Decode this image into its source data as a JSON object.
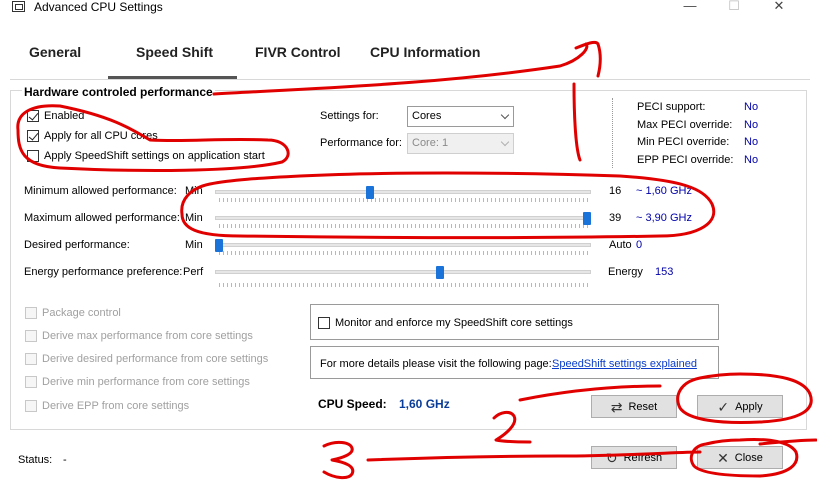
{
  "window": {
    "title": "Advanced CPU Settings",
    "minimize_glyph": "—",
    "maximize_glyph": "☐",
    "close_glyph": "✕"
  },
  "tabs": [
    {
      "label": "General",
      "active": false
    },
    {
      "label": "Speed Shift",
      "active": true
    },
    {
      "label": "FIVR Control",
      "active": false
    },
    {
      "label": "CPU Information",
      "active": false
    }
  ],
  "hardware": {
    "group_title": "Hardware controled performance",
    "enabled": {
      "label": "Enabled",
      "checked": true
    },
    "apply_all": {
      "label": "Apply for all CPU cores",
      "checked": true
    },
    "apply_on_start": {
      "label": "Apply SpeedShift settings on application start",
      "checked": false
    },
    "settings_for": {
      "label": "Settings for:",
      "value": "Cores"
    },
    "performance_for": {
      "label": "Performance for:",
      "value": "Core: 1"
    }
  },
  "peci": [
    {
      "label": "PECI support:",
      "value": "No"
    },
    {
      "label": "Max PECI override:",
      "value": "No"
    },
    {
      "label": "Min PECI override:",
      "value": "No"
    },
    {
      "label": "EPP PECI override:",
      "value": "No"
    }
  ],
  "sliders": {
    "min_perf": {
      "label": "Minimum allowed performance:",
      "left": "Min",
      "value": "16",
      "extra": "~ 1,60 GHz",
      "fraction": 0.41
    },
    "max_perf": {
      "label": "Maximum allowed performance:",
      "left": "Min",
      "value": "39",
      "extra": "~ 3,90 GHz",
      "fraction": 1.0
    },
    "desired": {
      "label": "Desired performance:",
      "left": "Min",
      "right": "Auto",
      "value": "0",
      "fraction": 0.0
    },
    "epp": {
      "label": "Energy performance preference:",
      "left": "Perf",
      "right": "Energy",
      "value": "153",
      "fraction": 0.6
    }
  },
  "package": {
    "package_control": "Package control",
    "derive_max": "Derive max performance from core settings",
    "derive_desired": "Derive desired performance from core settings",
    "derive_min": "Derive min performance from core settings",
    "derive_epp": "Derive EPP from core settings"
  },
  "monitor": {
    "label": "Monitor and enforce my SpeedShift core settings",
    "checked": false
  },
  "details": {
    "text": "For more details please visit the following page:",
    "link": "SpeedShift settings explained"
  },
  "cpu_speed": {
    "label": "CPU Speed:",
    "value": "1,60 GHz"
  },
  "buttons": {
    "reset": "Reset",
    "apply": "Apply",
    "refresh": "Refresh",
    "close": "Close"
  },
  "status": {
    "label": "Status:",
    "value": "-"
  },
  "annotations": {
    "one": "1",
    "two": "2",
    "three": "3"
  },
  "colors": {
    "accent_blue": "#1a73d9",
    "value_blue": "#0000aa",
    "link_blue": "#0a3cc9",
    "annotation_red": "#e00000"
  }
}
